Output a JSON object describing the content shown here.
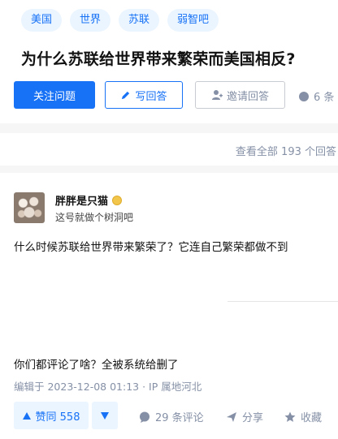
{
  "question": {
    "tags": [
      "美国",
      "世界",
      "苏联",
      "弱智吧"
    ],
    "title": "为什么苏联给世界带来繁荣而美国相反?",
    "follow_label": "关注问题",
    "write_label": "写回答",
    "invite_label": "邀请回答",
    "comments_label": "6 条"
  },
  "answers_bar": {
    "view_all_label": "查看全部 193 个回答"
  },
  "answer": {
    "author_name": "胖胖是只猫",
    "author_bio": "这号就做个树洞吧",
    "paragraph1": "什么时候苏联给世界带来繁荣了？它连自己繁荣都做不到",
    "paragraph2": "你们都评论了啥？全被系统给删了",
    "edited": "编辑于 2023-12-08 01:13 · IP 属地河北",
    "upvote_label": "赞同 558",
    "comments_label": "29 条评论",
    "share_label": "分享",
    "favorite_label": "收藏"
  },
  "colors": {
    "brand": "#1772f6",
    "tag_bg": "#ebf5ff",
    "muted": "#8590a6"
  },
  "icons": [
    "pencil-icon",
    "invite-person-icon",
    "comment-icon",
    "upvote-arrow-icon",
    "downvote-arrow-icon",
    "share-icon",
    "star-icon",
    "badge-icon"
  ]
}
